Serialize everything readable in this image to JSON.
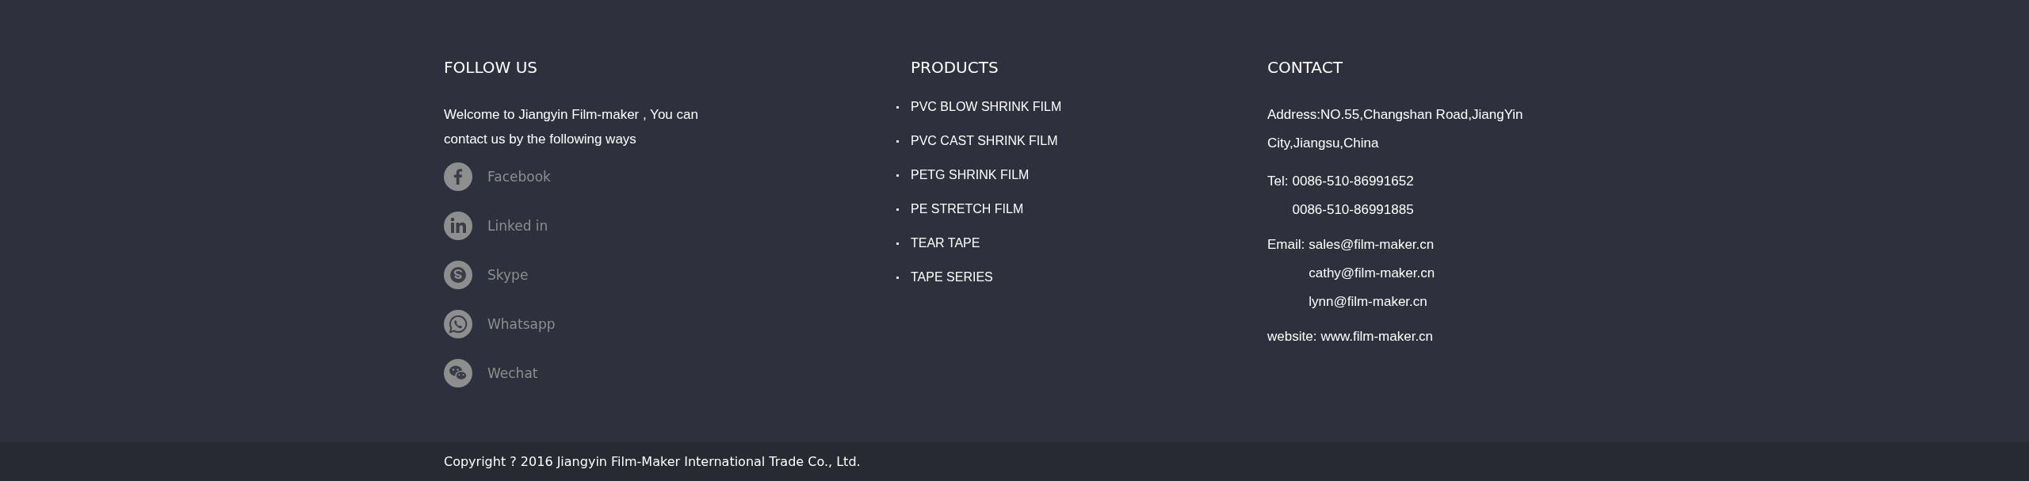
{
  "follow_us": {
    "title": "FOLLOW US",
    "intro": "Welcome to Jiangyin Film-maker , You can contact us by the following ways",
    "links": [
      {
        "kind": "facebook",
        "label": "Facebook"
      },
      {
        "kind": "linkedin",
        "label": "Linked in"
      },
      {
        "kind": "skype",
        "label": "Skype"
      },
      {
        "kind": "whatsapp",
        "label": "Whatsapp"
      },
      {
        "kind": "wechat",
        "label": "Wechat"
      }
    ]
  },
  "products": {
    "title": "PRODUCTS",
    "items": [
      "PVC BLOW SHRINK FILM",
      "PVC CAST SHRINK FILM",
      "PETG SHRINK FILM",
      "PE STRETCH FILM",
      "TEAR TAPE",
      "TAPE SERIES"
    ]
  },
  "contact": {
    "title": "CONTACT",
    "address": "Address:NO.55,Changshan Road,JiangYin City,Jiangsu,China",
    "tel": {
      "label": "Tel:",
      "values": [
        "0086-510-86991652",
        "0086-510-86991885"
      ]
    },
    "email": {
      "label": "Email:",
      "values": [
        "sales@film-maker.cn",
        "cathy@film-maker.cn",
        "lynn@film-maker.cn"
      ]
    },
    "website": {
      "label": "website:",
      "values": [
        "www.film-maker.cn"
      ]
    }
  },
  "copyright": "Copyright ? 2016 Jiangyin Film-Maker International Trade Co., Ltd."
}
